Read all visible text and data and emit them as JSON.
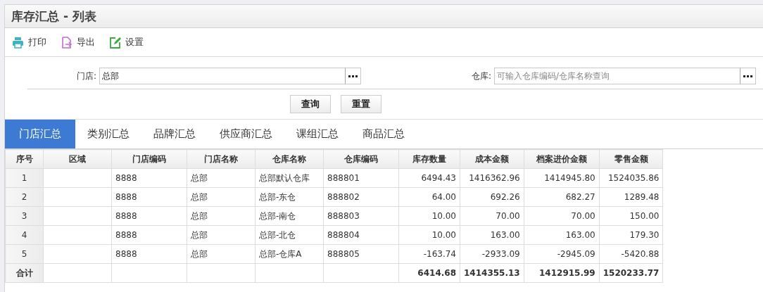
{
  "window": {
    "title": "库存汇总 - 列表"
  },
  "toolbar": [
    {
      "kind": "print",
      "label": "打印"
    },
    {
      "kind": "export",
      "label": "导出"
    },
    {
      "kind": "settings",
      "label": "设置"
    }
  ],
  "filters": [
    {
      "label": "门店:",
      "value": "总部"
    },
    {
      "label": "仓库:",
      "placeholder": "可输入仓库编码/仓库名称查询"
    }
  ],
  "buttons": [
    "查询",
    "重置"
  ],
  "tabs": [
    {
      "label": "门店汇总",
      "selected": true
    },
    {
      "label": "类别汇总",
      "selected": false
    },
    {
      "label": "品牌汇总",
      "selected": false
    },
    {
      "label": "供应商汇总",
      "selected": false
    },
    {
      "label": "课组汇总",
      "selected": false
    },
    {
      "label": "商品汇总",
      "selected": false
    }
  ],
  "table": {
    "columns": [
      "序号",
      "区域",
      "门店编码",
      "门店名称",
      "仓库名称",
      "仓库编码",
      "库存数量",
      "成本金额",
      "档案进价金额",
      "零售金额"
    ],
    "rows": [
      {
        "index": "1",
        "store_code": "8888",
        "store_name": "总部",
        "warehouse_name": "总部默认仓库",
        "warehouse_code": "888801",
        "quantity": "6494.43",
        "cost": "1416362.96",
        "purchase_amount": "1414945.80",
        "retail_amount": "1524035.86"
      },
      {
        "index": "2",
        "store_code": "8888",
        "store_name": "总部",
        "warehouse_name": "总部-东仓",
        "warehouse_code": "888802",
        "quantity": "64.00",
        "cost": "692.26",
        "purchase_amount": "682.27",
        "retail_amount": "1289.48"
      },
      {
        "index": "3",
        "store_code": "8888",
        "store_name": "总部",
        "warehouse_name": "总部-南仓",
        "warehouse_code": "888803",
        "quantity": "10.00",
        "cost": "70.00",
        "purchase_amount": "70.00",
        "retail_amount": "150.00"
      },
      {
        "index": "4",
        "store_code": "8888",
        "store_name": "总部",
        "warehouse_name": "总部-北仓",
        "warehouse_code": "888804",
        "quantity": "10.00",
        "cost": "163.00",
        "purchase_amount": "163.00",
        "retail_amount": "179.30"
      },
      {
        "index": "5",
        "store_code": "8888",
        "store_name": "总部",
        "warehouse_name": "总部-仓库A",
        "warehouse_code": "888805",
        "quantity": "-163.74",
        "cost": "-2933.09",
        "purchase_amount": "-2945.09",
        "retail_amount": "-5420.88"
      }
    ],
    "total": {
      "label": "合计",
      "quantity": "6414.68",
      "cost": "1414355.13",
      "purchase_amount": "1412915.99",
      "retail_amount": "1520233.77"
    }
  }
}
